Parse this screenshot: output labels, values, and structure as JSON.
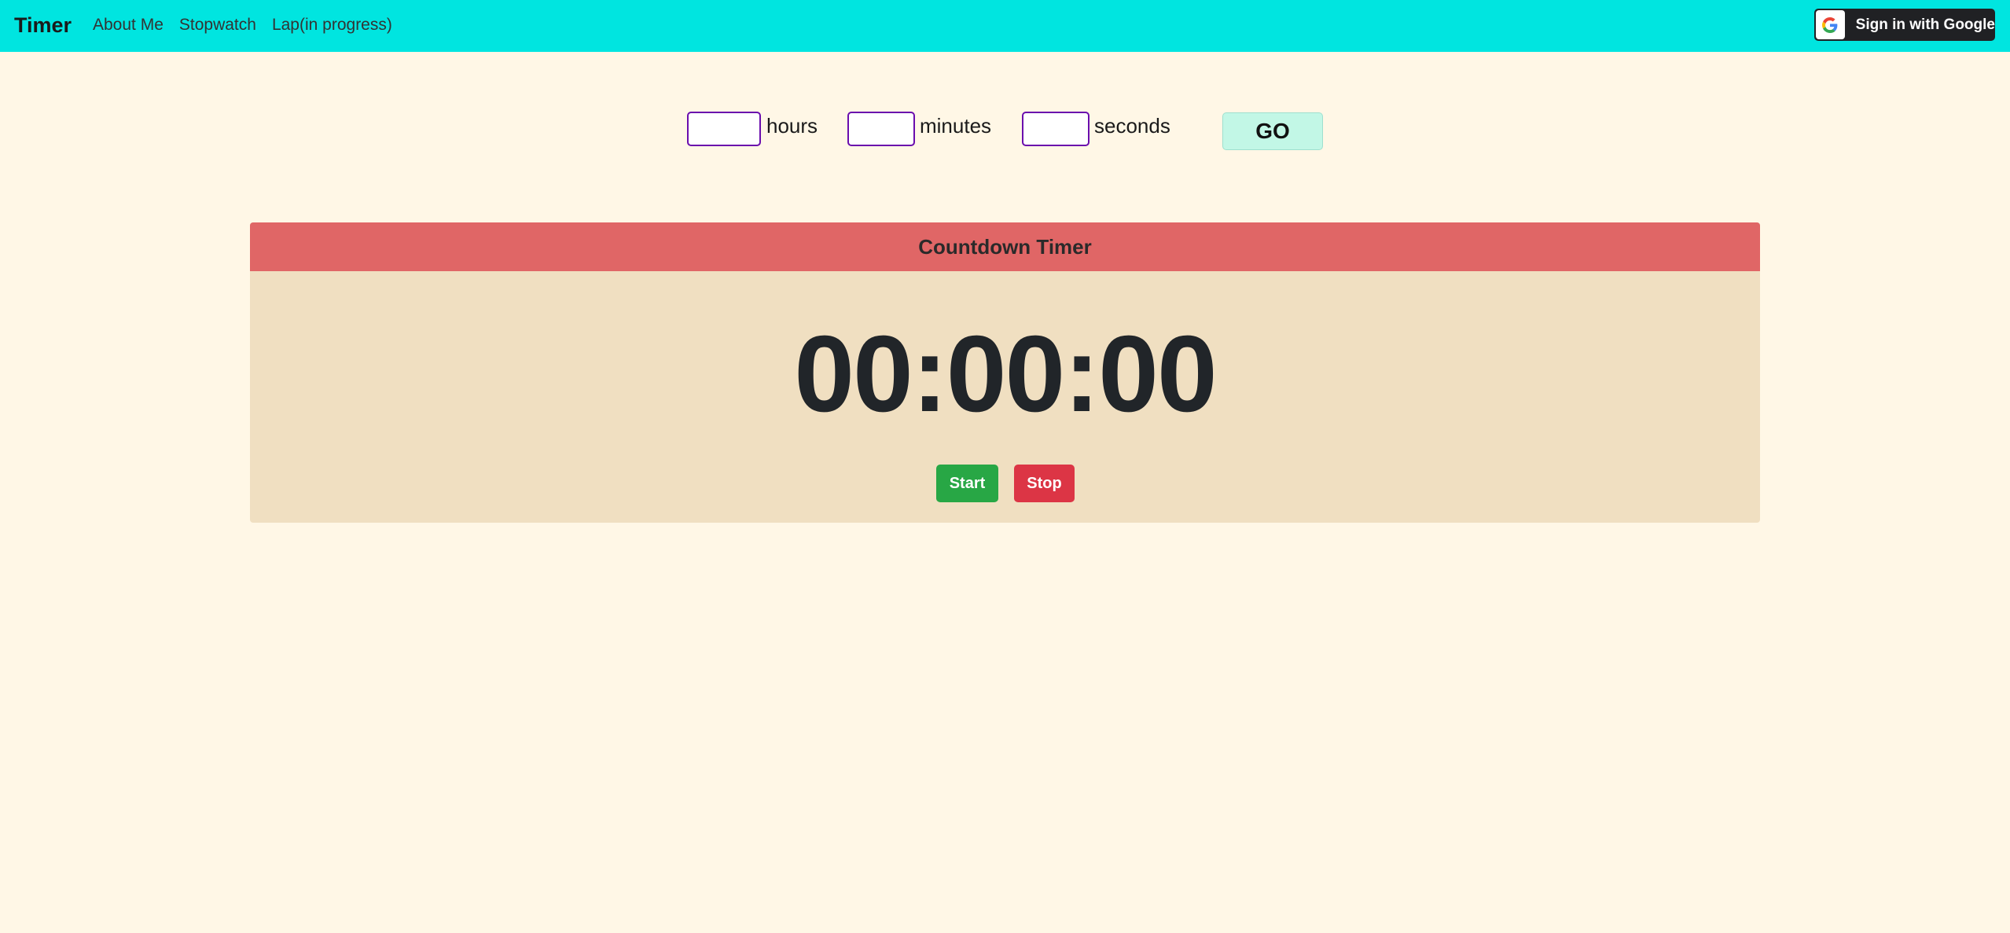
{
  "navbar": {
    "brand": "Timer",
    "links": [
      "About Me",
      "Stopwatch",
      "Lap(in progress)"
    ],
    "signin_label": "Sign in with Google"
  },
  "time_inputs": {
    "hours": {
      "value": "",
      "label": "hours"
    },
    "minutes": {
      "value": "",
      "label": "minutes"
    },
    "seconds": {
      "value": "",
      "label": "seconds"
    },
    "go_label": "GO"
  },
  "timer_card": {
    "title": "Countdown Timer",
    "display": "00:00:00",
    "start_label": "Start",
    "stop_label": "Stop"
  },
  "colors": {
    "navbar": "#00e5e0",
    "page_background": "#fff7e6",
    "card_header": "#e06666",
    "card_body": "#f0dfc1",
    "start": "#28a745",
    "stop": "#dc3545",
    "go": "#c2f7e6",
    "input_border": "#6a0dad"
  }
}
